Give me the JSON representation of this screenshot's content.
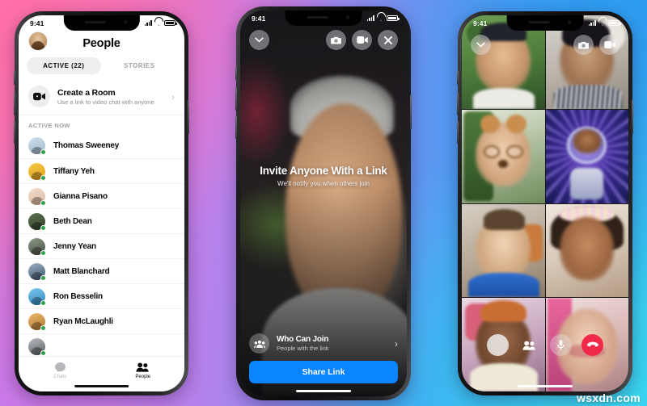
{
  "watermark": "wsxdn.com",
  "phone_people": {
    "status_bar": {
      "time": "9:41"
    },
    "header": {
      "title": "People"
    },
    "tabs": [
      {
        "label": "ACTIVE (22)",
        "state": "active"
      },
      {
        "label": "STORIES",
        "state": "inactive"
      }
    ],
    "create_room": {
      "title": "Create a Room",
      "subtitle": "Use a link to video chat with anyone"
    },
    "section_header": "ACTIVE NOW",
    "contacts": [
      {
        "name": "Thomas Sweeney",
        "online": true
      },
      {
        "name": "Tiffany Yeh",
        "online": true
      },
      {
        "name": "Gianna Pisano",
        "online": true
      },
      {
        "name": "Beth Dean",
        "online": true
      },
      {
        "name": "Jenny Yean",
        "online": true
      },
      {
        "name": "Matt Blanchard",
        "online": true
      },
      {
        "name": "Ron Besselin",
        "online": true
      },
      {
        "name": "Ryan McLaughli",
        "online": true
      }
    ],
    "tabbar": [
      {
        "label": "Chats",
        "state": "inactive"
      },
      {
        "label": "People",
        "state": "active"
      }
    ]
  },
  "phone_invite": {
    "status_bar": {
      "time": "9:41"
    },
    "headline": "Invite Anyone With a Link",
    "subhead": "We'll notify you when others join",
    "who_can_join": {
      "title": "Who Can Join",
      "subtitle": "People with the link"
    },
    "share_button": {
      "label": "Share Link",
      "color": "#0a84ff"
    }
  },
  "phone_call": {
    "status_bar": {
      "time": "9:41"
    },
    "participant_count": 8,
    "end_call_color": "#f02849"
  },
  "colors": {
    "online_green": "#31a24c",
    "accent_blue": "#0a84ff",
    "end_red": "#f02849",
    "bg_pink": "#ff74ae",
    "bg_purple": "#c97ce8",
    "bg_blue": "#3f9ef2",
    "bg_cyan": "#35cdee"
  }
}
